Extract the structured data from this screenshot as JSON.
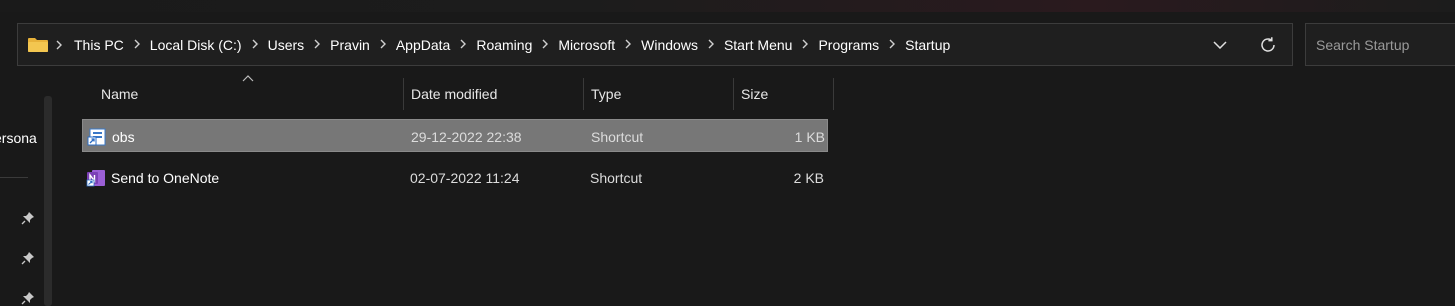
{
  "address_bar": {
    "breadcrumbs": [
      "This PC",
      "Local Disk (C:)",
      "Users",
      "Pravin",
      "AppData",
      "Roaming",
      "Microsoft",
      "Windows",
      "Start Menu",
      "Programs",
      "Startup"
    ],
    "separator_icon": "chevron-right-icon",
    "dropdown_icon": "chevron-down-icon",
    "refresh_icon": "refresh-icon"
  },
  "search": {
    "placeholder": "Search Startup"
  },
  "nav_pane": {
    "visible_label": "ersona",
    "pin_icon": "pin-icon"
  },
  "columns": {
    "name": "Name",
    "date": "Date modified",
    "type": "Type",
    "size": "Size"
  },
  "files": [
    {
      "name": "obs",
      "date": "29-12-2022 22:38",
      "type": "Shortcut",
      "size": "1 KB",
      "selected": true,
      "icon": "shortcut-icon"
    },
    {
      "name": "Send to OneNote",
      "date": "02-07-2022 11:24",
      "type": "Shortcut",
      "size": "2 KB",
      "selected": false,
      "icon": "onenote-icon"
    }
  ],
  "colors": {
    "background": "#191919",
    "selected_row": "#777777",
    "folder": "#e8b23a",
    "onenote": "#7b3fb6"
  }
}
